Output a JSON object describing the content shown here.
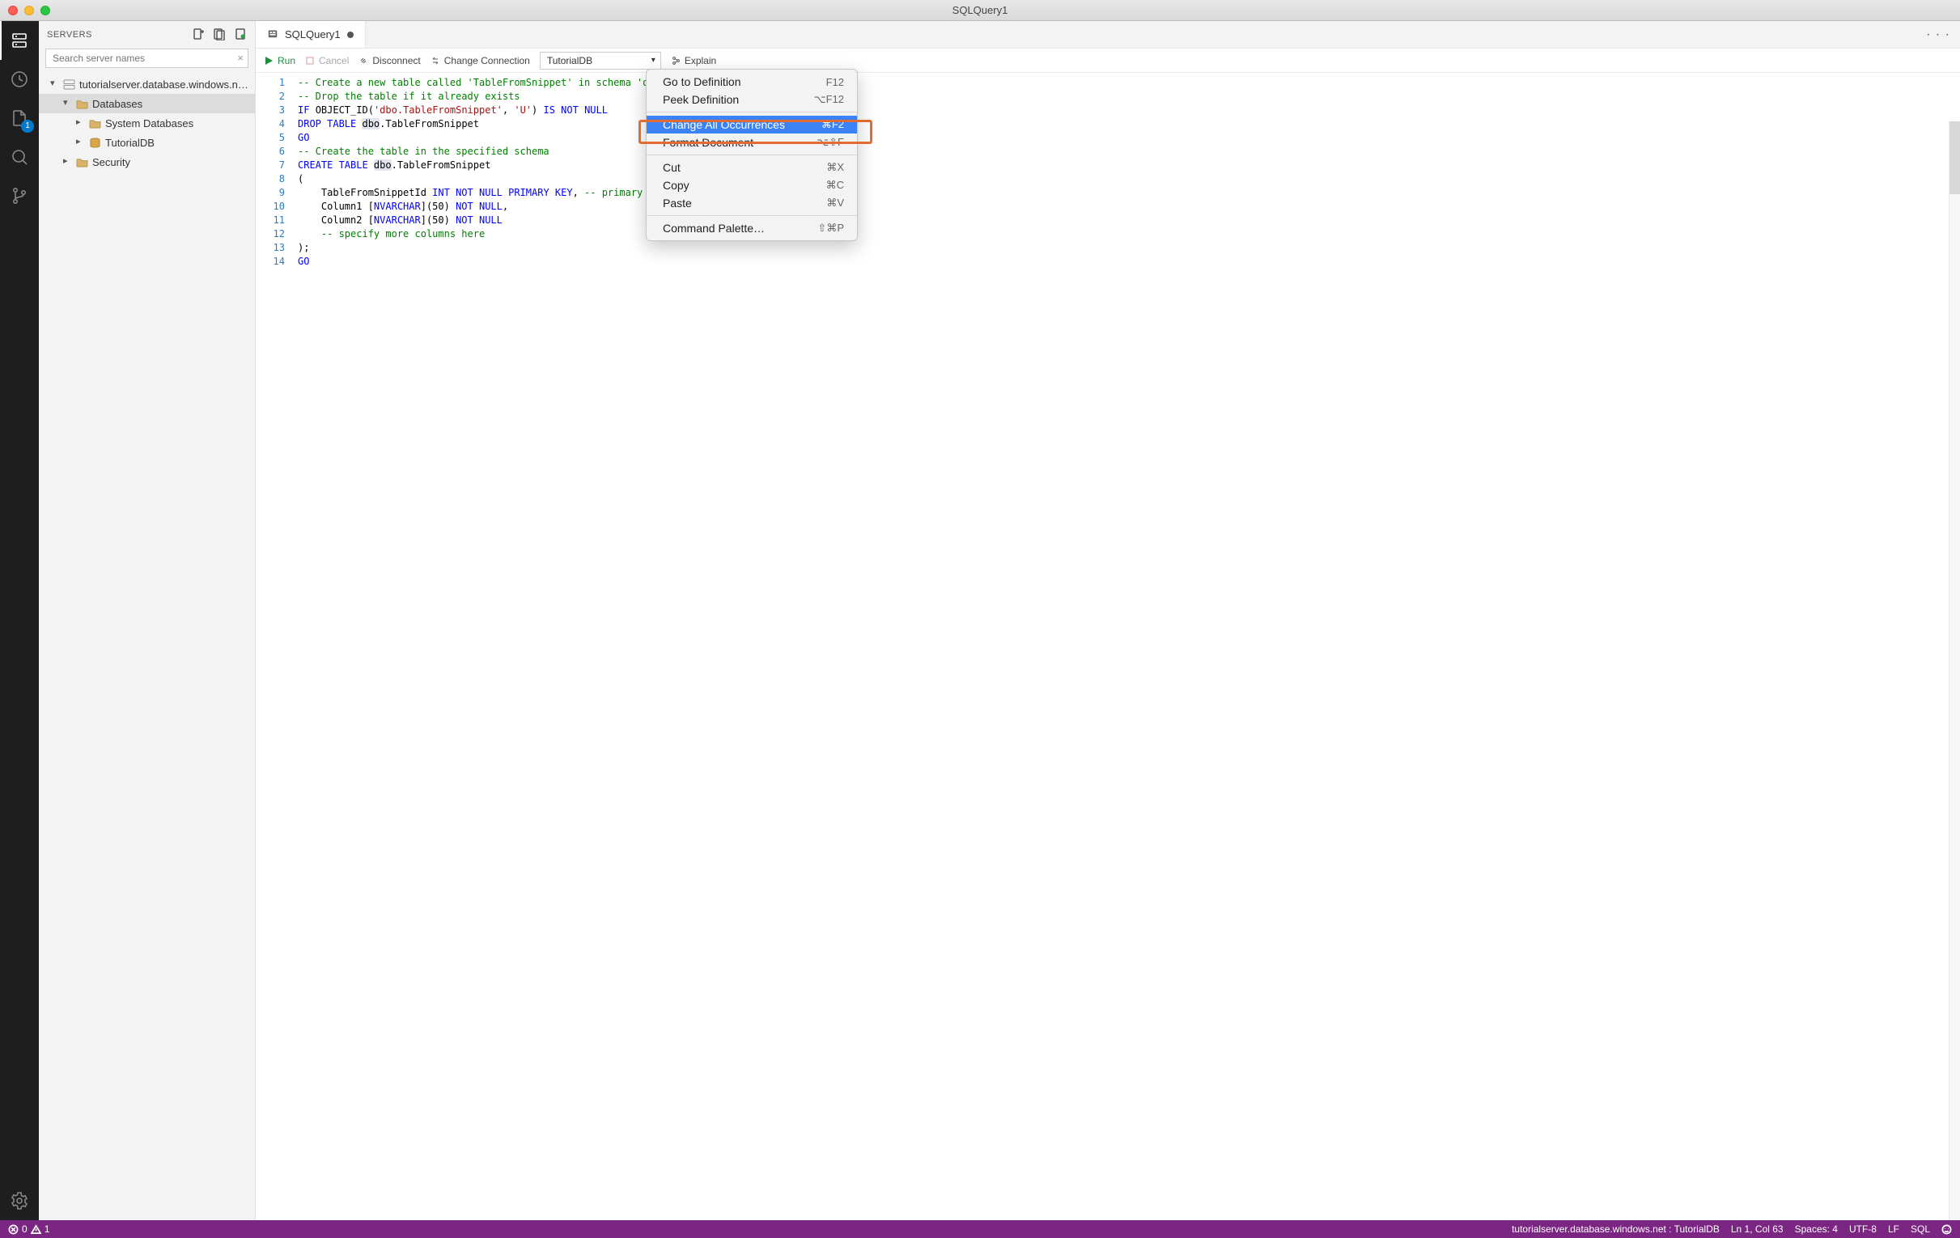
{
  "window": {
    "title": "SQLQuery1"
  },
  "activitybar": {
    "explorer_badge": "1"
  },
  "sidebar": {
    "title": "SERVERS",
    "search_placeholder": "Search server names",
    "tree": {
      "server": "tutorialserver.database.windows.n…",
      "databases": "Databases",
      "system_db": "System Databases",
      "tutorialdb": "TutorialDB",
      "security": "Security"
    }
  },
  "tab": {
    "label": "SQLQuery1"
  },
  "overflow": "· · ·",
  "toolbar": {
    "run": "Run",
    "cancel": "Cancel",
    "disconnect": "Disconnect",
    "change_conn": "Change Connection",
    "db_selected": "TutorialDB",
    "explain": "Explain"
  },
  "code": {
    "lines": [
      "1",
      "2",
      "3",
      "4",
      "5",
      "6",
      "7",
      "8",
      "9",
      "10",
      "11",
      "12",
      "13",
      "14"
    ],
    "l1_a": "-- Create a new table called ",
    "l1_b": "'TableFromSnippet'",
    "l1_c": " in schema ",
    "l1_d": "'dbo",
    "l2": "-- Drop the table if it already exists",
    "l3_a": "IF ",
    "l3_b": "OBJECT_ID",
    "l3_c": "(",
    "l3_d": "'dbo.TableFromSnippet'",
    "l3_e": ", ",
    "l3_f": "'U'",
    "l3_g": ") ",
    "l3_h": "IS NOT NULL",
    "l4_a": "DROP TABLE ",
    "l4_b": "dbo",
    "l4_c": ".TableFromSnippet",
    "l5": "GO",
    "l6": "-- Create the table in the specified schema",
    "l7_a": "CREATE TABLE ",
    "l7_b": "dbo",
    "l7_c": ".TableFromSnippet",
    "l8": "(",
    "l9_a": "    TableFromSnippetId ",
    "l9_b": "INT NOT NULL PRIMARY KEY",
    "l9_c": ", ",
    "l9_d": "-- primary key",
    "l10_a": "    Column1 [",
    "l10_b": "NVARCHAR",
    "l10_c": "](",
    "l10_d": "50",
    "l10_e": ") ",
    "l10_f": "NOT NULL",
    "l10_g": ",",
    "l11_a": "    Column2 [",
    "l11_b": "NVARCHAR",
    "l11_c": "](",
    "l11_d": "50",
    "l11_e": ") ",
    "l11_f": "NOT NULL",
    "l12": "    -- specify more columns here",
    "l13": ");",
    "l14": "GO"
  },
  "context_menu": {
    "goto_def": {
      "label": "Go to Definition",
      "shortcut": "F12"
    },
    "peek_def": {
      "label": "Peek Definition",
      "shortcut": "⌥F12"
    },
    "change_all": {
      "label": "Change All Occurrences",
      "shortcut": "⌘F2"
    },
    "format": {
      "label": "Format Document",
      "shortcut": "⌥⇧F"
    },
    "cut": {
      "label": "Cut",
      "shortcut": "⌘X"
    },
    "copy": {
      "label": "Copy",
      "shortcut": "⌘C"
    },
    "paste": {
      "label": "Paste",
      "shortcut": "⌘V"
    },
    "palette": {
      "label": "Command Palette…",
      "shortcut": "⇧⌘P"
    }
  },
  "status": {
    "errors": "0",
    "warnings": "1",
    "connection": "tutorialserver.database.windows.net : TutorialDB",
    "position": "Ln 1, Col 63",
    "spaces": "Spaces: 4",
    "encoding": "UTF-8",
    "eol": "LF",
    "language": "SQL"
  }
}
